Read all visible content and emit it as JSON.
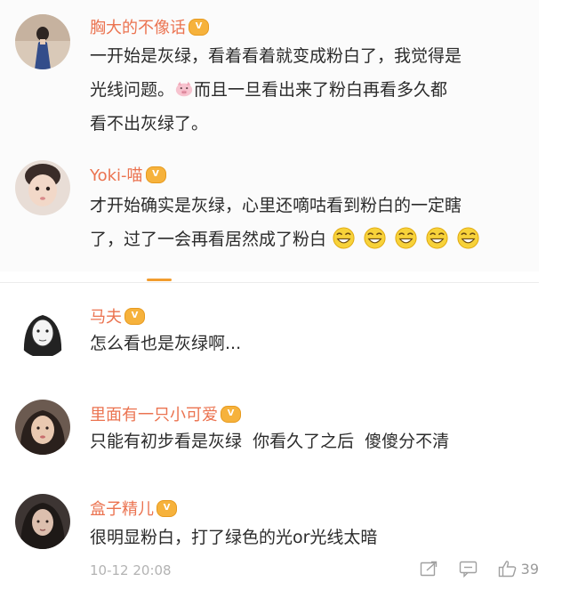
{
  "comments": [
    {
      "username": "胸大的不像话",
      "vip_label": "V",
      "lines": [
        "一开始是灰绿，看着看着就变成粉白了，我觉得是",
        "光线问题。",
        "而且一旦看出来了粉白再看多久都",
        "看不出灰绿了。"
      ]
    },
    {
      "username": "Yoki-喵",
      "vip_label": "V",
      "lines": [
        "才开始确实是灰绿，心里还嘀咕看到粉白的一定瞎",
        "了，过了一会再看居然成了粉白"
      ]
    },
    {
      "username": "马夫",
      "vip_label": "V",
      "lines": [
        "怎么看也是灰绿啊..."
      ]
    },
    {
      "username": "里面有一只小可爱",
      "vip_label": "V",
      "lines": [
        "只能有初步看是灰绿  你看久了之后  傻傻分不清"
      ]
    },
    {
      "username": "盒子精儿",
      "vip_label": "V",
      "lines": [
        "很明显粉白，打了绿色的光or光线太暗"
      ]
    }
  ],
  "footer": {
    "timestamp": "10-12 20:08",
    "like_count": "39"
  },
  "icons": {
    "pig": "pig-face-emoji",
    "laugh": "grinning-laugh-emoji",
    "share": "share-icon",
    "comment": "comment-icon",
    "like": "thumbs-up-icon"
  },
  "colors": {
    "username": "#eb7350",
    "vip": "#f6b23c",
    "accent_tab": "#f29d2f"
  }
}
